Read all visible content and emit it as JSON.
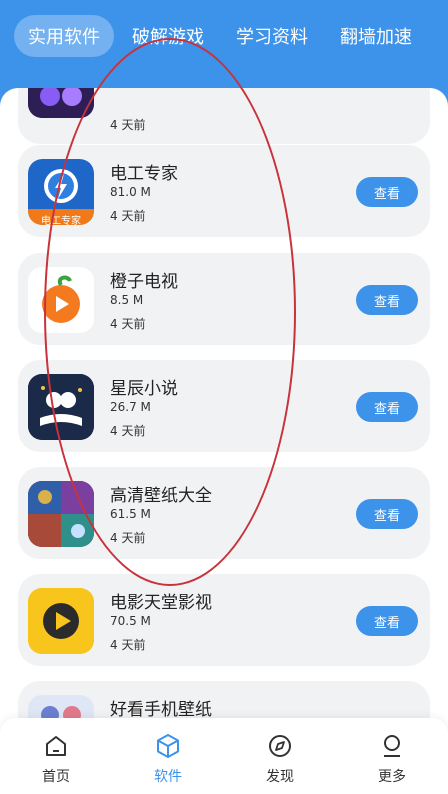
{
  "colors": {
    "accent": "#3d93ea",
    "annotation": "#c8323a"
  },
  "tabs": [
    {
      "label": "实用软件",
      "active": true
    },
    {
      "label": "破解游戏",
      "active": false
    },
    {
      "label": "学习资料",
      "active": false
    },
    {
      "label": "翻墙加速",
      "active": false
    }
  ],
  "apps": [
    {
      "name": "",
      "size": "",
      "time": "4 天前",
      "icon": "partial-app-icon"
    },
    {
      "name": "电工专家",
      "size": "81.0 M",
      "time": "4 天前",
      "icon": "electrician-icon",
      "icon_text": "电工专家",
      "button": "查看"
    },
    {
      "name": "橙子电视",
      "size": "8.5 M",
      "time": "4 天前",
      "icon": "orange-tv-icon",
      "button": "查看"
    },
    {
      "name": "星辰小说",
      "size": "26.7 M",
      "time": "4 天前",
      "icon": "novel-icon",
      "button": "查看"
    },
    {
      "name": "高清壁纸大全",
      "size": "61.5 M",
      "time": "4 天前",
      "icon": "wallpaper-icon",
      "button": "查看"
    },
    {
      "name": "电影天堂影视",
      "size": "70.5 M",
      "time": "4 天前",
      "icon": "movie-icon",
      "button": "查看"
    },
    {
      "name": "好看手机壁纸",
      "size": "",
      "time": "",
      "icon": "phone-wallpaper-icon",
      "button": ""
    }
  ],
  "nav": [
    {
      "label": "首页",
      "icon": "home-icon",
      "active": false
    },
    {
      "label": "软件",
      "icon": "cube-icon",
      "active": true
    },
    {
      "label": "发现",
      "icon": "compass-icon",
      "active": false
    },
    {
      "label": "更多",
      "icon": "user-icon",
      "active": false
    }
  ]
}
